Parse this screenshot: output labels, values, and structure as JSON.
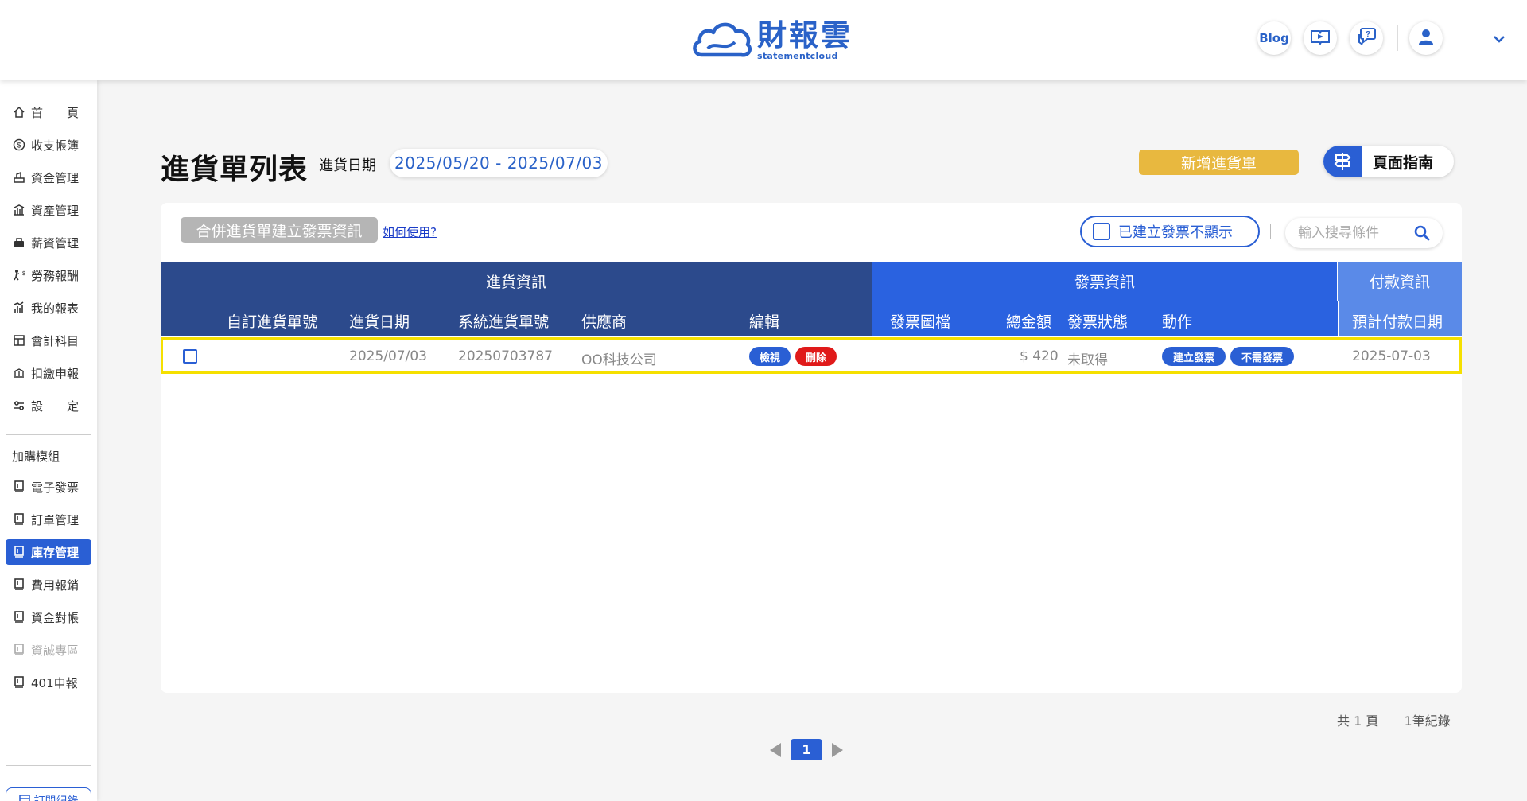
{
  "header": {
    "logo_cn": "財報雲",
    "logo_en": "statementcloud",
    "blog_label": "Blog"
  },
  "sidebar": {
    "items": [
      {
        "label": "首　　頁",
        "icon": "home-icon"
      },
      {
        "label": "收支帳簿",
        "icon": "coin-icon"
      },
      {
        "label": "資金管理",
        "icon": "fund-icon"
      },
      {
        "label": "資產管理",
        "icon": "asset-icon"
      },
      {
        "label": "薪資管理",
        "icon": "salary-icon"
      },
      {
        "label": "勞務報酬",
        "icon": "labor-icon"
      },
      {
        "label": "我的報表",
        "icon": "chart-icon"
      },
      {
        "label": "會計科目",
        "icon": "account-icon"
      },
      {
        "label": "扣繳申報",
        "icon": "tax-icon"
      },
      {
        "label": "設　　定",
        "icon": "settings-icon"
      }
    ],
    "section_label": "加購模組",
    "modules": [
      {
        "label": "電子發票",
        "state": "normal"
      },
      {
        "label": "訂單管理",
        "state": "normal"
      },
      {
        "label": "庫存管理",
        "state": "active"
      },
      {
        "label": "費用報銷",
        "state": "normal"
      },
      {
        "label": "資金對帳",
        "state": "normal"
      },
      {
        "label": "資誠專區",
        "state": "disabled"
      },
      {
        "label": "401申報",
        "state": "normal"
      }
    ],
    "bottom_button": "訂閱紀錄"
  },
  "page": {
    "title": "進貨單列表",
    "date_label": "進貨日期",
    "date_range": "2025/05/20 - 2025/07/03",
    "add_button": "新增進貨單",
    "guide_button": "頁面指南"
  },
  "toolbar": {
    "merge_button": "合併進貨單建立發票資訊",
    "howto_link": "如何使用?",
    "hide_created_label": "已建立發票不顯示",
    "search_placeholder": "輸入搜尋條件"
  },
  "table": {
    "groups": {
      "purchase": "進貨資訊",
      "invoice": "發票資訊",
      "payment": "付款資訊"
    },
    "columns": {
      "custom_no": "自訂進貨單號",
      "purchase_date": "進貨日期",
      "system_no": "系統進貨單號",
      "supplier": "供應商",
      "edit": "編輯",
      "invoice_file": "發票圖檔",
      "total": "總金額",
      "invoice_status": "發票狀態",
      "action": "動作",
      "expected_pay_date": "預計付款日期"
    },
    "rows": [
      {
        "custom_no": "",
        "purchase_date": "2025/07/03",
        "system_no": "20250703787",
        "supplier": "OO科技公司",
        "view_label": "檢視",
        "delete_label": "刪除",
        "total": "$ 420",
        "invoice_status": "未取得",
        "create_invoice_label": "建立發票",
        "no_invoice_label": "不需發票",
        "expected_pay_date": "2025-07-03"
      }
    ]
  },
  "pagination": {
    "total_pages": "共 1 頁",
    "total_records": "1筆紀錄",
    "current_page": "1"
  },
  "colors": {
    "primary": "#2a5fd4",
    "header_dark": "#2c4a8c",
    "header_invoice": "#2a62e0",
    "header_payment": "#5a8ae8",
    "accent_yellow": "#e8b83f",
    "danger": "#e01a1a",
    "highlight": "#f5e000"
  }
}
